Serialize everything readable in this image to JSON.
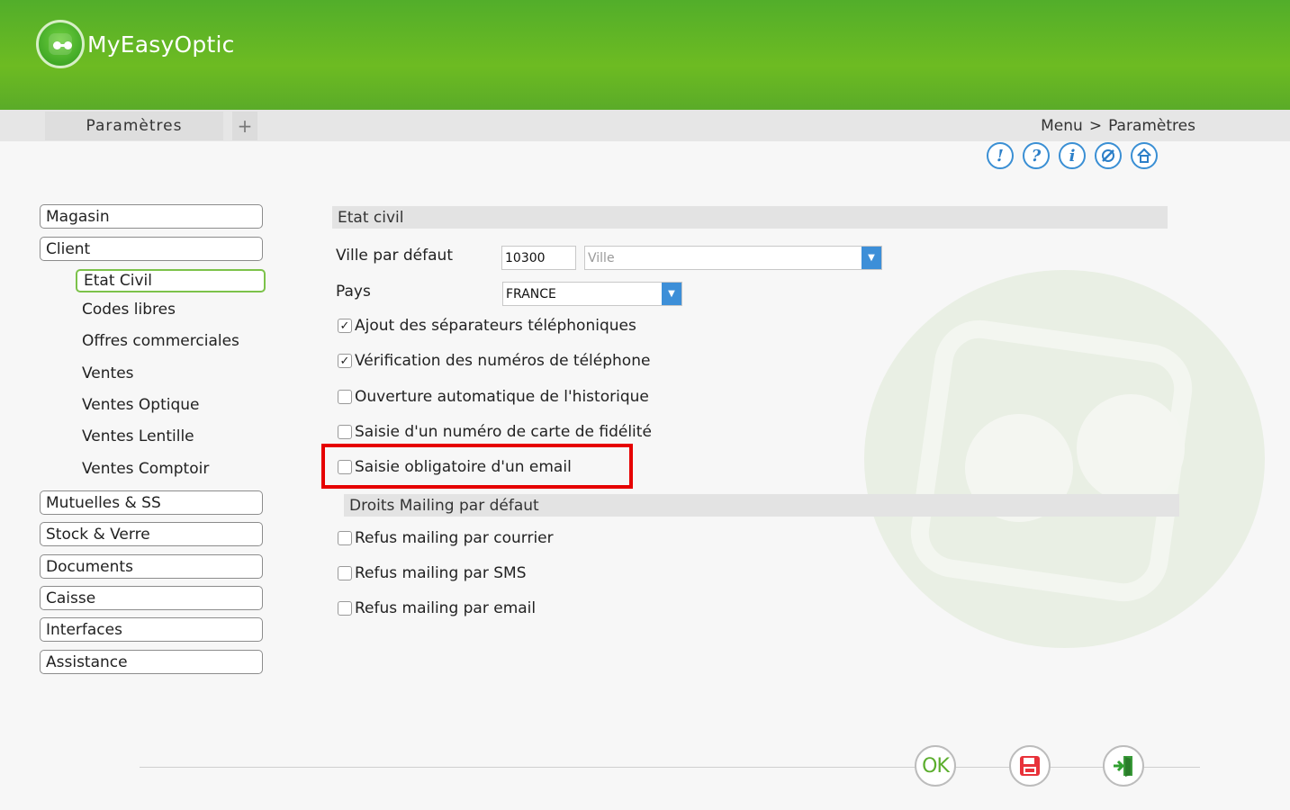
{
  "app": {
    "title": "MyEasyOptic"
  },
  "tabs": {
    "active_label": "Paramètres",
    "add_label": "+"
  },
  "breadcrumb": {
    "root": "Menu",
    "separator": ">",
    "current": "Paramètres"
  },
  "toolbar_icons": [
    {
      "name": "alert-icon",
      "glyph": "!"
    },
    {
      "name": "help-icon",
      "glyph": "?"
    },
    {
      "name": "info-icon",
      "glyph": "i"
    },
    {
      "name": "tools-icon",
      "glyph": "⚙"
    },
    {
      "name": "home-icon",
      "glyph": "⌂"
    }
  ],
  "sidebar": {
    "magasin": "Magasin",
    "client": "Client",
    "sub": {
      "etat_civil": "Etat Civil",
      "codes_libres": "Codes libres",
      "offres": "Offres commerciales",
      "ventes": "Ventes",
      "ventes_optique": "Ventes Optique",
      "ventes_lentille": "Ventes Lentille",
      "ventes_comptoir": "Ventes Comptoir"
    },
    "mutuelles": "Mutuelles & SS",
    "stock": "Stock & Verre",
    "documents": "Documents",
    "caisse": "Caisse",
    "interfaces": "Interfaces",
    "assistance": "Assistance"
  },
  "etat_civil": {
    "section_title": "Etat civil",
    "ville_label": "Ville par défaut",
    "postal_code": "10300",
    "ville_placeholder": "Ville",
    "pays_label": "Pays",
    "pays_value": "FRANCE",
    "options": {
      "separateurs": {
        "label": "Ajout des séparateurs téléphoniques",
        "checked": true
      },
      "verification": {
        "label": "Vérification des numéros de téléphone",
        "checked": true
      },
      "historique": {
        "label": "Ouverture automatique de l'historique",
        "checked": false
      },
      "fidelite": {
        "label": "Saisie d'un numéro de carte de fidélité",
        "checked": false
      },
      "email_obligatoire": {
        "label": "Saisie obligatoire d'un email",
        "checked": false
      }
    }
  },
  "mailing": {
    "section_title": "Droits Mailing par défaut",
    "options": {
      "courrier": {
        "label": "Refus mailing par courrier",
        "checked": false
      },
      "sms": {
        "label": "Refus mailing par SMS",
        "checked": false
      },
      "email": {
        "label": "Refus mailing par email",
        "checked": false
      }
    }
  },
  "footer": {
    "ok_label": "OK"
  },
  "colors": {
    "header_green": "#6dbb22",
    "accent_blue": "#3d8fd8",
    "highlight_red": "#e60000",
    "active_border": "#7cc24a"
  }
}
